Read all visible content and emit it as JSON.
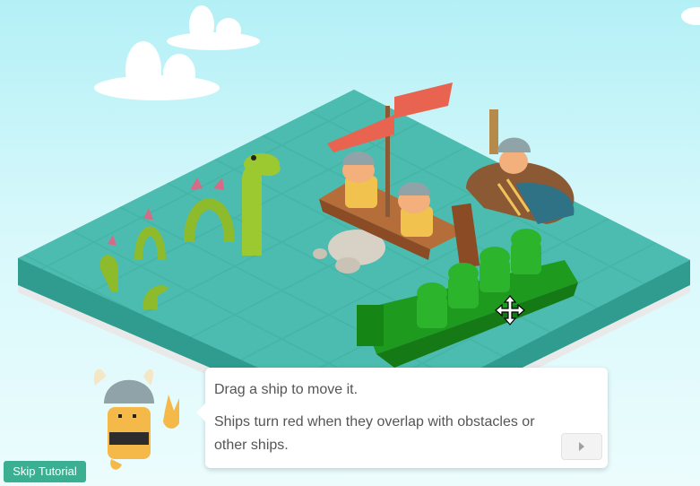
{
  "tooltip": {
    "line1": "Drag a ship to move it.",
    "line2": "Ships turn red when they overlap with obstacles or other ships."
  },
  "buttons": {
    "skip_tutorial": "Skip Tutorial"
  },
  "icons": {
    "next": "play-triangle-icon",
    "drag": "move-arrows-icon"
  },
  "colors": {
    "sky": "#c6f4f8",
    "water": "#43b8aa",
    "selected_ship": "#1a8f1a",
    "skip_button": "#3aaf92"
  }
}
